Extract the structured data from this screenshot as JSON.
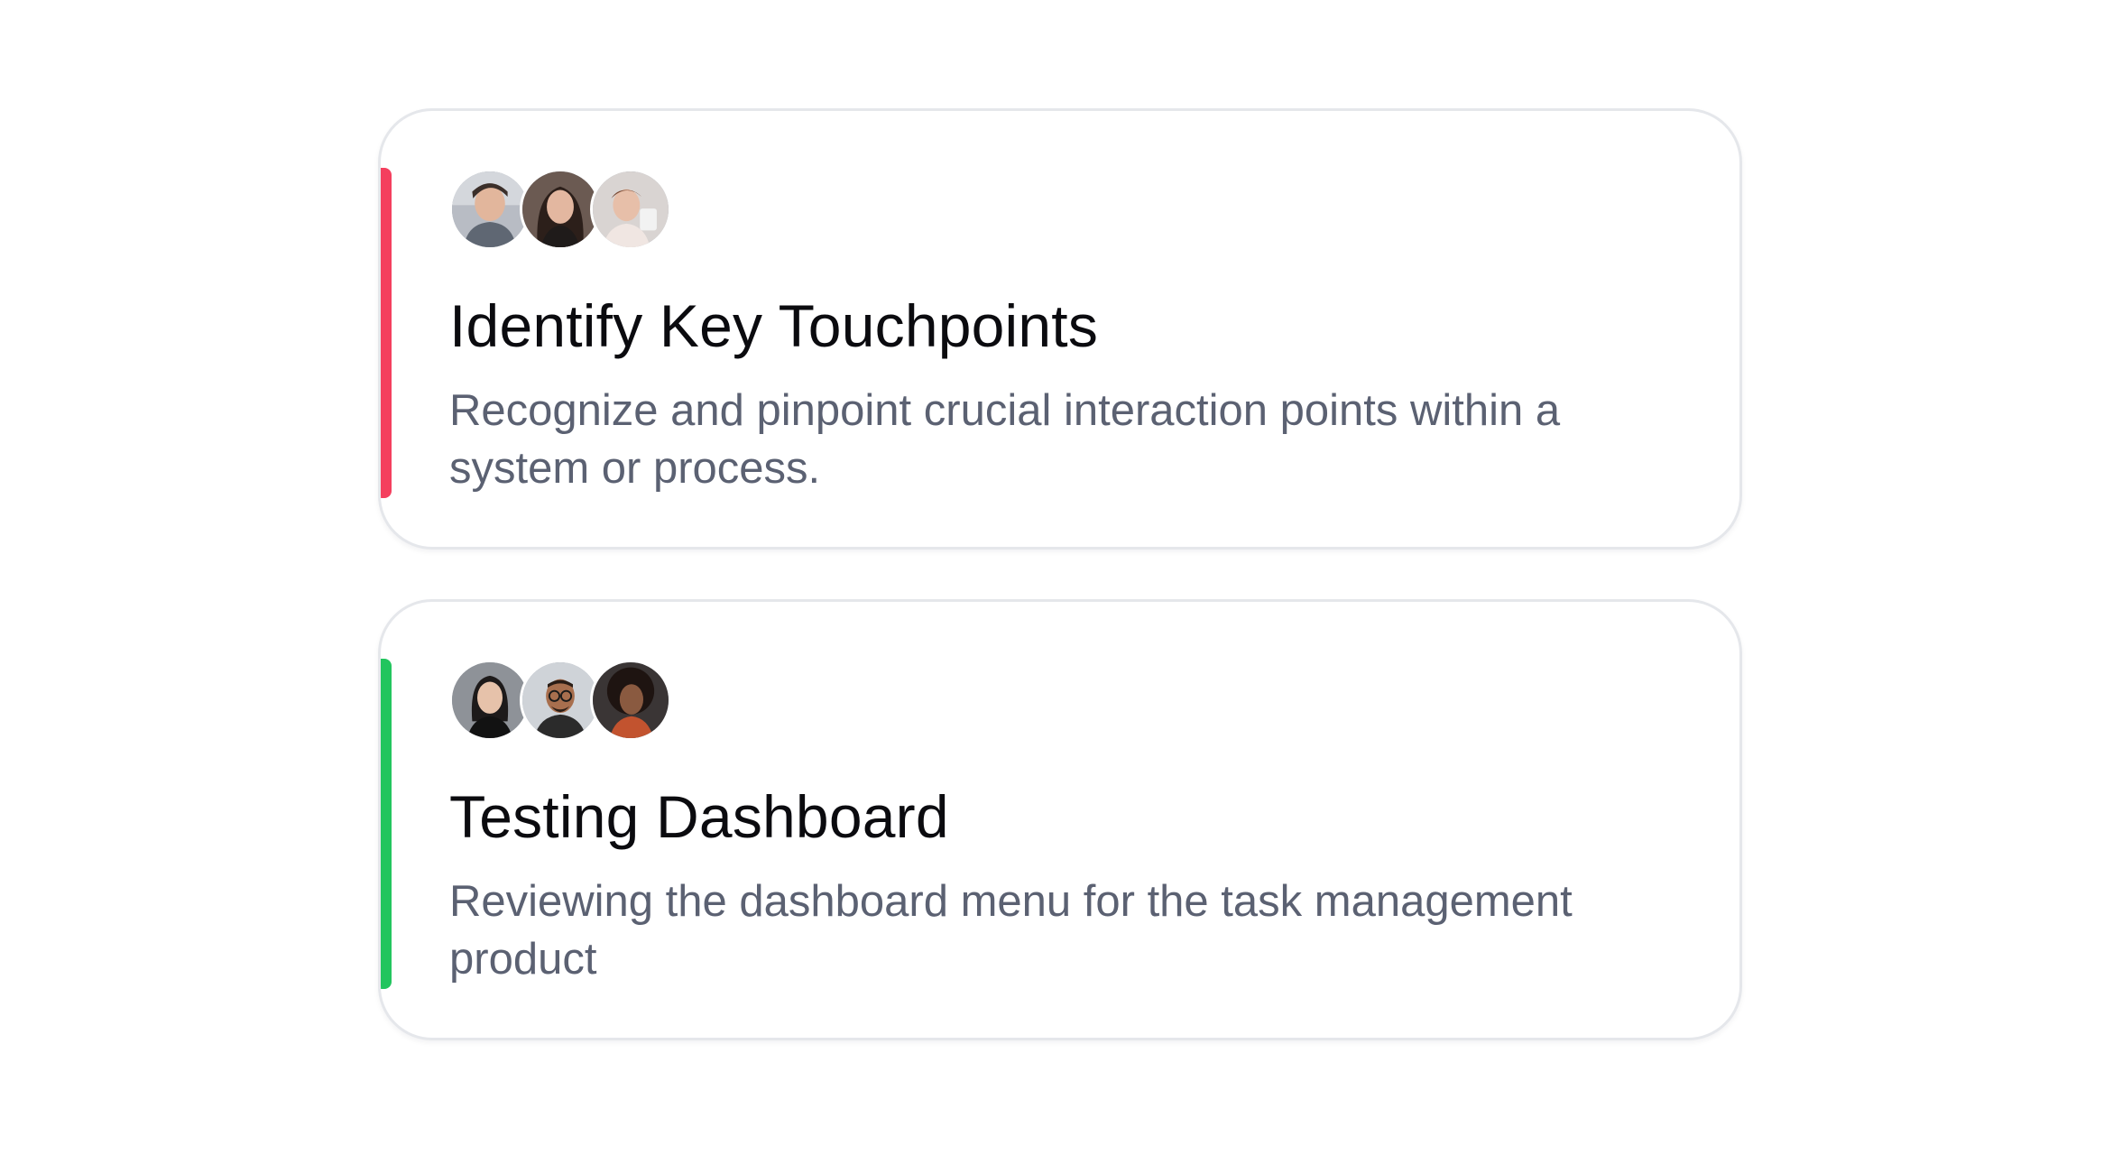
{
  "colors": {
    "accent_red": "#f43f5e",
    "accent_green": "#22c55e",
    "card_border": "#e5e7eb",
    "title_text": "#0b0b0f",
    "desc_text": "#5b6172"
  },
  "cards": [
    {
      "accent": "red",
      "title": "Identify Key Touchpoints",
      "description": "Recognize and pinpoint crucial interaction points within a system or process.",
      "avatars": [
        "avatar-person-1",
        "avatar-person-2",
        "avatar-person-3"
      ]
    },
    {
      "accent": "green",
      "title": "Testing Dashboard",
      "description": "Reviewing the dashboard menu for the task management product",
      "avatars": [
        "avatar-person-4",
        "avatar-person-5",
        "avatar-person-6"
      ]
    }
  ]
}
